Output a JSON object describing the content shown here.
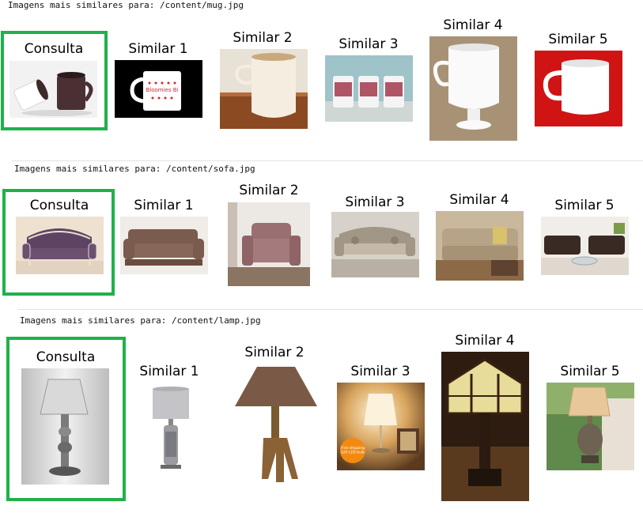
{
  "rows": [
    {
      "header": "Imagens mais similares para: /content/mug.jpg",
      "query_label": "Consulta",
      "similar_labels": [
        "Similar 1",
        "Similar 2",
        "Similar 3",
        "Similar 4",
        "Similar 5"
      ]
    },
    {
      "header": "Imagens mais similares para: /content/sofa.jpg",
      "query_label": "Consulta",
      "similar_labels": [
        "Similar 1",
        "Similar 2",
        "Similar 3",
        "Similar 4",
        "Similar 5"
      ]
    },
    {
      "header": "Imagens mais similares para: /content/lamp.jpg",
      "query_label": "Consulta",
      "similar_labels": [
        "Similar 1",
        "Similar 2",
        "Similar 3",
        "Similar 4",
        "Similar 5"
      ]
    }
  ],
  "image_text": {
    "mug_similar1_print": "Bloomies Bi",
    "lamp_similar3_badge": "Free shipping\n$20 LED bulb"
  },
  "colors": {
    "query_border": "#20b14a"
  }
}
